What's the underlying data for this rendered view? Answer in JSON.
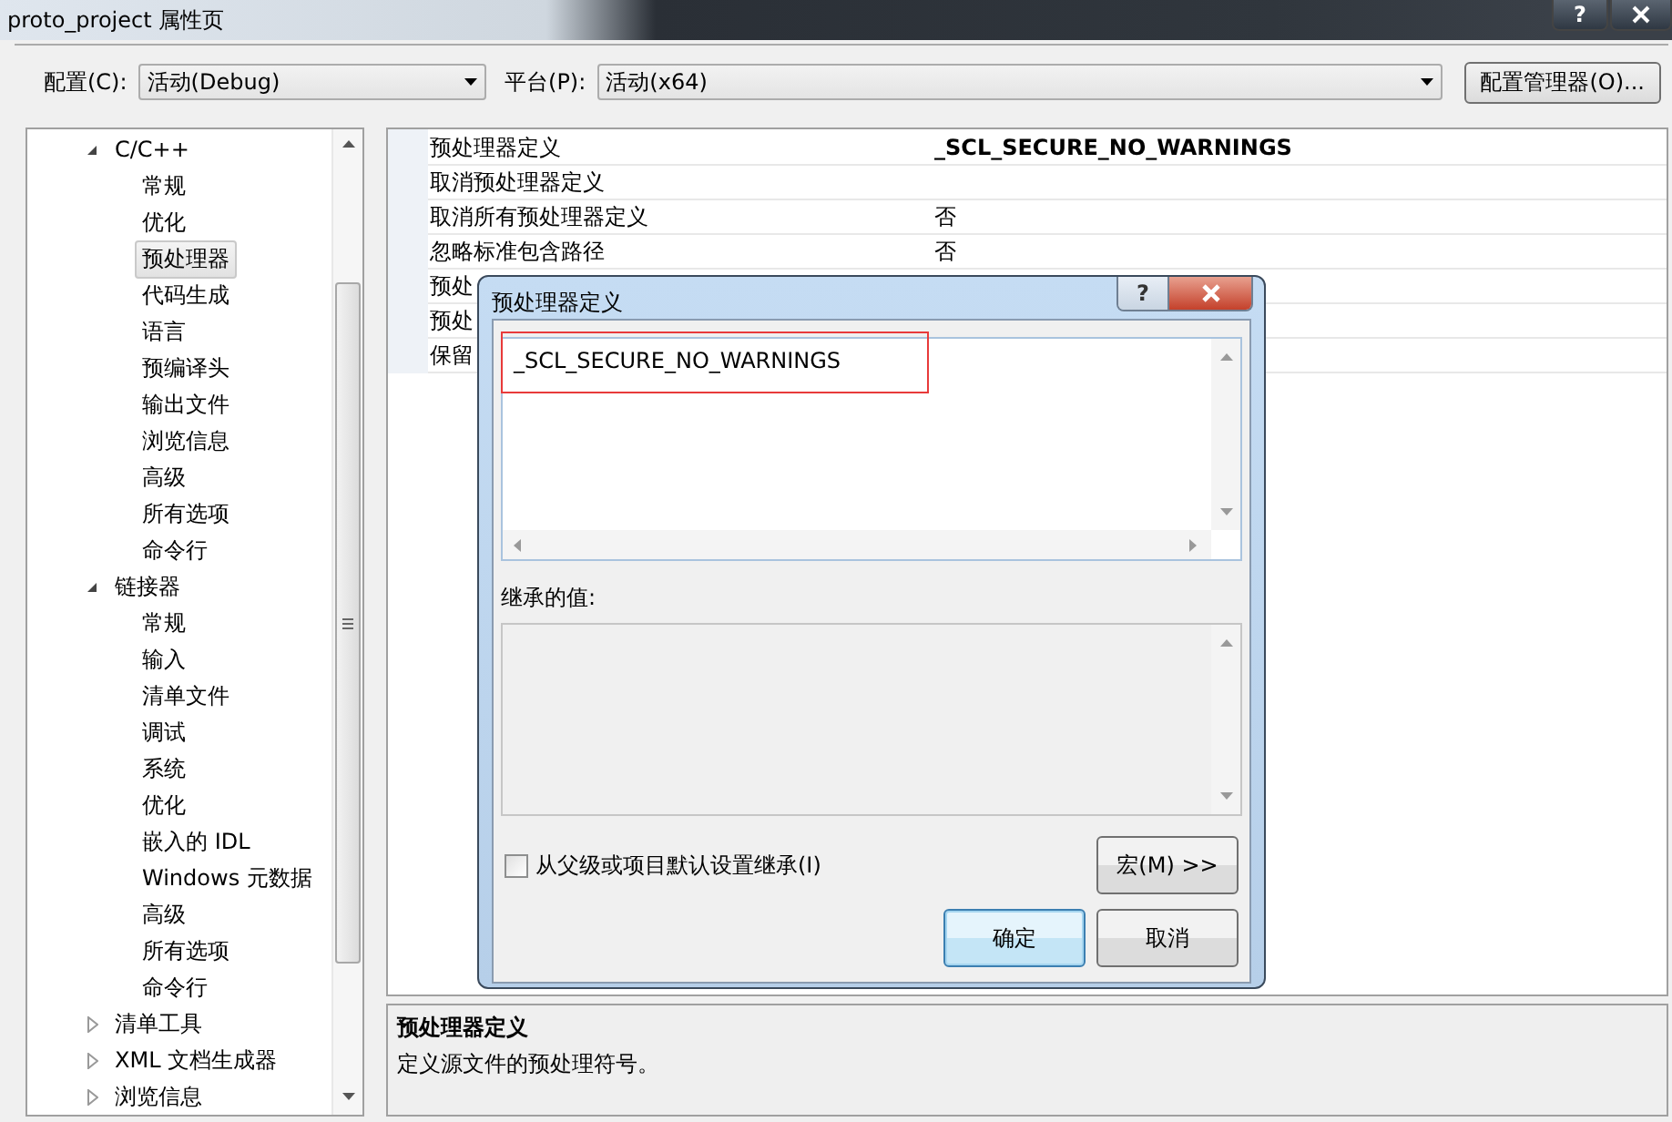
{
  "window": {
    "title": "proto_project 属性页",
    "help": "?"
  },
  "toolbar": {
    "config_label": "配置(C):",
    "config_value": "活动(Debug)",
    "platform_label": "平台(P):",
    "platform_value": "活动(x64)",
    "manager_button": "配置管理器(O)..."
  },
  "tree": {
    "items": [
      {
        "label": "C/C++",
        "expanded": true,
        "selected": false,
        "children": [
          {
            "label": "常规",
            "selected": false
          },
          {
            "label": "优化",
            "selected": false
          },
          {
            "label": "预处理器",
            "selected": true
          },
          {
            "label": "代码生成",
            "selected": false
          },
          {
            "label": "语言",
            "selected": false
          },
          {
            "label": "预编译头",
            "selected": false
          },
          {
            "label": "输出文件",
            "selected": false
          },
          {
            "label": "浏览信息",
            "selected": false
          },
          {
            "label": "高级",
            "selected": false
          },
          {
            "label": "所有选项",
            "selected": false
          },
          {
            "label": "命令行",
            "selected": false
          }
        ]
      },
      {
        "label": "链接器",
        "expanded": true,
        "selected": false,
        "children": [
          {
            "label": "常规",
            "selected": false
          },
          {
            "label": "输入",
            "selected": false
          },
          {
            "label": "清单文件",
            "selected": false
          },
          {
            "label": "调试",
            "selected": false
          },
          {
            "label": "系统",
            "selected": false
          },
          {
            "label": "优化",
            "selected": false
          },
          {
            "label": "嵌入的 IDL",
            "selected": false
          },
          {
            "label": "Windows 元数据",
            "selected": false
          },
          {
            "label": "高级",
            "selected": false
          },
          {
            "label": "所有选项",
            "selected": false
          },
          {
            "label": "命令行",
            "selected": false
          }
        ]
      },
      {
        "label": "清单工具",
        "expanded": false,
        "selected": false
      },
      {
        "label": "XML 文档生成器",
        "expanded": false,
        "selected": false
      },
      {
        "label": "浏览信息",
        "expanded": false,
        "selected": false
      }
    ]
  },
  "grid": {
    "rows": [
      {
        "name": "预处理器定义",
        "value": "_SCL_SECURE_NO_WARNINGS",
        "modified": true
      },
      {
        "name": "取消预处理器定义"
      },
      {
        "name": "取消所有预处理器定义",
        "value": "否",
        "modified": false
      },
      {
        "name": "忽略标准包含路径",
        "value": "否",
        "modified": false
      },
      {
        "name": "预处"
      },
      {
        "name": "预处"
      },
      {
        "name": "保留"
      }
    ]
  },
  "description": {
    "title": "预处理器定义",
    "text": "定义源文件的预处理符号。"
  },
  "dialog": {
    "title": "预处理器定义",
    "help": "?",
    "value": "_SCL_SECURE_NO_WARNINGS",
    "inherited_label": "继承的值:",
    "inherit": {
      "label": "从父级或项目默认设置继承(I)",
      "checked": false
    },
    "macros_button": "宏(M) >>",
    "ok_button": "确定",
    "cancel_button": "取消"
  }
}
